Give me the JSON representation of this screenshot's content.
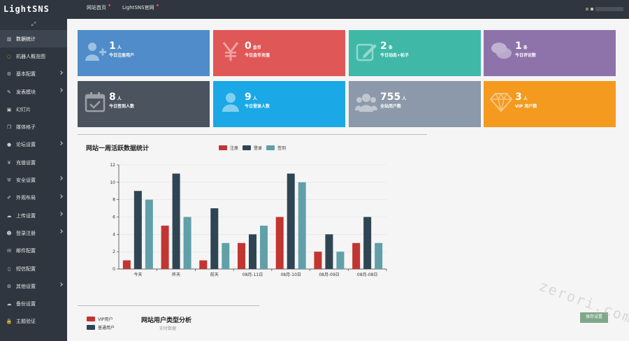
{
  "app": {
    "logo": "LightSNS"
  },
  "topnav": [
    {
      "label": "网站首页"
    },
    {
      "label": "LightSNS官网"
    }
  ],
  "sidebar": {
    "items": [
      {
        "label": "数据统计",
        "icon": "bar-chart-icon",
        "glyph": "▥",
        "active": true,
        "chevron": false
      },
      {
        "label": "机器人概览图",
        "icon": "robot-icon",
        "glyph": "◌",
        "active": false,
        "chevron": false
      },
      {
        "label": "基本配置",
        "icon": "gear-icon",
        "glyph": "⚙",
        "active": false,
        "chevron": true
      },
      {
        "label": "发表模块",
        "icon": "edit-icon",
        "glyph": "✎",
        "active": false,
        "chevron": true
      },
      {
        "label": "幻灯片",
        "icon": "image-icon",
        "glyph": "▣",
        "active": false,
        "chevron": false
      },
      {
        "label": "媒体格子",
        "icon": "copy-icon",
        "glyph": "❐",
        "active": false,
        "chevron": false
      },
      {
        "label": "论坛设置",
        "icon": "comments-icon",
        "glyph": "●",
        "active": false,
        "chevron": true
      },
      {
        "label": "充值设置",
        "icon": "yen-icon",
        "glyph": "¥",
        "active": false,
        "chevron": false
      },
      {
        "label": "安全设置",
        "icon": "shield-icon",
        "glyph": "⛨",
        "active": false,
        "chevron": true
      },
      {
        "label": "外观布局",
        "icon": "brush-icon",
        "glyph": "✐",
        "active": false,
        "chevron": true
      },
      {
        "label": "上传设置",
        "icon": "cloud-upload-icon",
        "glyph": "☁",
        "active": false,
        "chevron": true
      },
      {
        "label": "登录注册",
        "icon": "user-icon",
        "glyph": "☻",
        "active": false,
        "chevron": true
      },
      {
        "label": "邮件配置",
        "icon": "envelope-icon",
        "glyph": "✉",
        "active": false,
        "chevron": false
      },
      {
        "label": "短信配置",
        "icon": "mobile-icon",
        "glyph": "▯",
        "active": false,
        "chevron": false
      },
      {
        "label": "其他设置",
        "icon": "cogs-icon",
        "glyph": "⚙",
        "active": false,
        "chevron": true
      },
      {
        "label": "备份设置",
        "icon": "cloud-icon",
        "glyph": "☁",
        "active": false,
        "chevron": false
      },
      {
        "label": "主题验证",
        "icon": "lock-icon",
        "glyph": "🔒",
        "active": false,
        "chevron": false
      }
    ]
  },
  "cards": [
    {
      "value": "1",
      "unit": "人",
      "label": "今日注册用户",
      "color": "#4f8cc9",
      "icon": "user-plus-icon"
    },
    {
      "value": "0",
      "unit": "金币",
      "label": "今日金币充值",
      "color": "#e05757",
      "icon": "yen-icon"
    },
    {
      "value": "2",
      "unit": "条",
      "label": "今日动态+帖子",
      "color": "#3fb8a8",
      "icon": "edit-icon"
    },
    {
      "value": "1",
      "unit": "条",
      "label": "今日评论数",
      "color": "#8e73ab",
      "icon": "comments-icon"
    },
    {
      "value": "8",
      "unit": "人",
      "label": "今日签到人数",
      "color": "#4a535e",
      "icon": "calendar-check-icon"
    },
    {
      "value": "9",
      "unit": "人",
      "label": "今日登录人数",
      "color": "#1aa8e6",
      "icon": "user-icon"
    },
    {
      "value": "755",
      "unit": "人",
      "label": "全站用户数",
      "color": "#8c99aa",
      "icon": "users-icon"
    },
    {
      "value": "3",
      "unit": "人",
      "label": "VIP 用户数",
      "color": "#f39a1f",
      "icon": "diamond-icon"
    }
  ],
  "chart_data": {
    "type": "bar",
    "title": "网站一周活跃数据统计",
    "categories": [
      "今天",
      "昨天",
      "前天",
      "08月-11日",
      "08月-10日",
      "08月-09日",
      "08月-08日"
    ],
    "series": [
      {
        "name": "注册",
        "color": "#c23531",
        "values": [
          1,
          5,
          1,
          3,
          6,
          2,
          3
        ]
      },
      {
        "name": "登录",
        "color": "#2f4554",
        "values": [
          9,
          11,
          7,
          4,
          11,
          4,
          6
        ]
      },
      {
        "name": "签到",
        "color": "#61a0a8",
        "values": [
          8,
          6,
          3,
          5,
          10,
          2,
          3
        ]
      }
    ],
    "yticks": [
      "0",
      "2",
      "4",
      "6",
      "8",
      "10",
      "12"
    ],
    "ylim": [
      0,
      12
    ],
    "grid": true,
    "legend": "top"
  },
  "pie": {
    "title": "网站用户类型分析",
    "subtitle": "实时数据",
    "legend": [
      {
        "name": "VIP用户",
        "color": "#c23531"
      },
      {
        "name": "普通用户",
        "color": "#2f4554"
      }
    ]
  },
  "actions": {
    "save_label": "保存设置"
  },
  "watermark": "zerori.com"
}
